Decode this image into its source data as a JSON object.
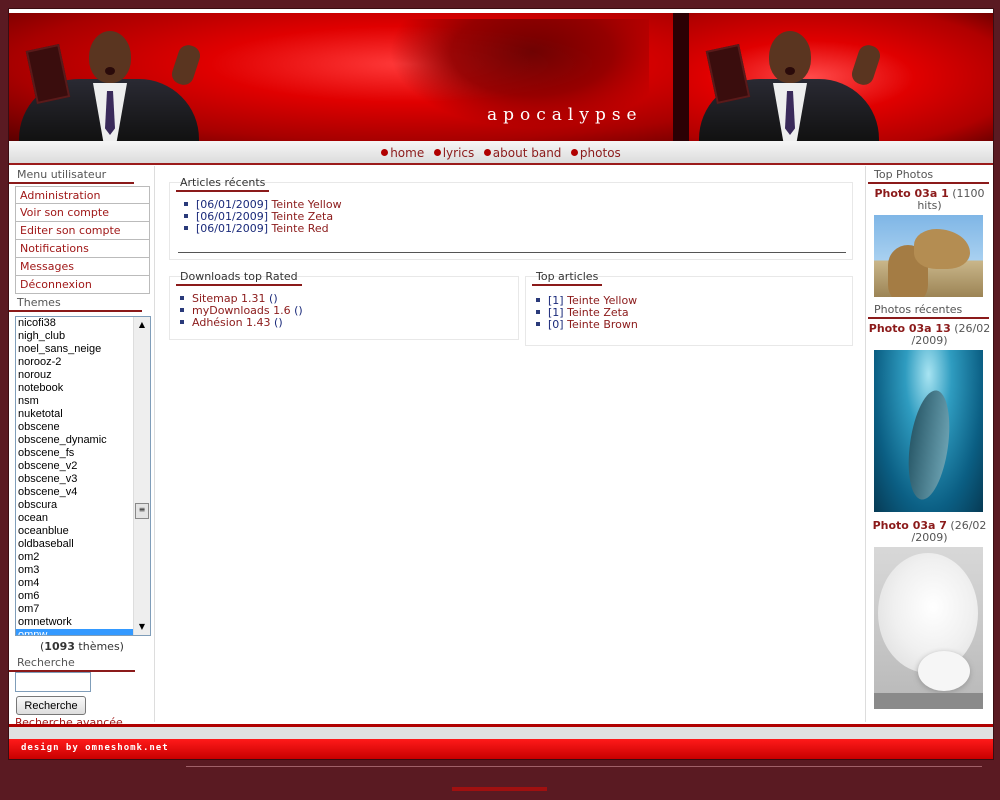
{
  "header": {
    "logo_text": "apocalypse"
  },
  "nav": {
    "items": [
      {
        "label": "home"
      },
      {
        "label": "lyrics"
      },
      {
        "label": "about band"
      },
      {
        "label": "photos"
      }
    ]
  },
  "user_menu": {
    "title": "Menu utilisateur",
    "items": [
      {
        "label": "Administration"
      },
      {
        "label": "Voir son compte"
      },
      {
        "label": "Editer son compte"
      },
      {
        "label": "Notifications"
      },
      {
        "label": "Messages"
      },
      {
        "label": "Déconnexion"
      }
    ]
  },
  "themes": {
    "title": "Themes",
    "items": [
      "nicofi38",
      "nigh_club",
      "noel_sans_neige",
      "norooz-2",
      "norouz",
      "notebook",
      "nsm",
      "nuketotal",
      "obscene",
      "obscene_dynamic",
      "obscene_fs",
      "obscene_v2",
      "obscene_v3",
      "obscene_v4",
      "obscura",
      "ocean",
      "oceanblue",
      "oldbaseball",
      "om2",
      "om3",
      "om4",
      "om6",
      "om7",
      "omnetwork",
      "omnw"
    ],
    "selected": "omnw",
    "count_prefix": "(",
    "count": "1093",
    "count_suffix": " thèmes)"
  },
  "search": {
    "title": "Recherche",
    "input_value": "",
    "button_label": "Recherche",
    "advanced_label": "Recherche avancée"
  },
  "recent_articles": {
    "title": "Articles récents",
    "items": [
      {
        "date": "[06/01/2009]",
        "title": "Teinte Yellow"
      },
      {
        "date": "[06/01/2009]",
        "title": "Teinte Zeta"
      },
      {
        "date": "[06/01/2009]",
        "title": "Teinte Red"
      }
    ]
  },
  "downloads": {
    "title": "Downloads top Rated",
    "items": [
      {
        "name": "Sitemap 1.31",
        "extra": " ()"
      },
      {
        "name": "myDownloads 1.6",
        "extra": " ()"
      },
      {
        "name": "Adhésion 1.43",
        "extra": " ()"
      }
    ]
  },
  "top_articles": {
    "title": "Top articles",
    "items": [
      {
        "count": "[1]",
        "title": "Teinte Yellow"
      },
      {
        "count": "[1]",
        "title": "Teinte Zeta"
      },
      {
        "count": "[0]",
        "title": "Teinte Brown"
      }
    ]
  },
  "top_photos": {
    "title": "Top Photos",
    "photo": {
      "name": "Photo 03a 1",
      "meta": " (1100 hits)"
    }
  },
  "recent_photos": {
    "title": "Photos récentes",
    "items": [
      {
        "name": "Photo 03a 13",
        "meta": " (26/02 /2009)"
      },
      {
        "name": "Photo 03a 7",
        "meta": " (26/02 /2009)"
      }
    ]
  },
  "footer": {
    "credit": "design by omneshomk.net"
  },
  "colors": {
    "accent": "#8b1a1a",
    "background": "#5a1a22",
    "banner": "#e00000"
  }
}
